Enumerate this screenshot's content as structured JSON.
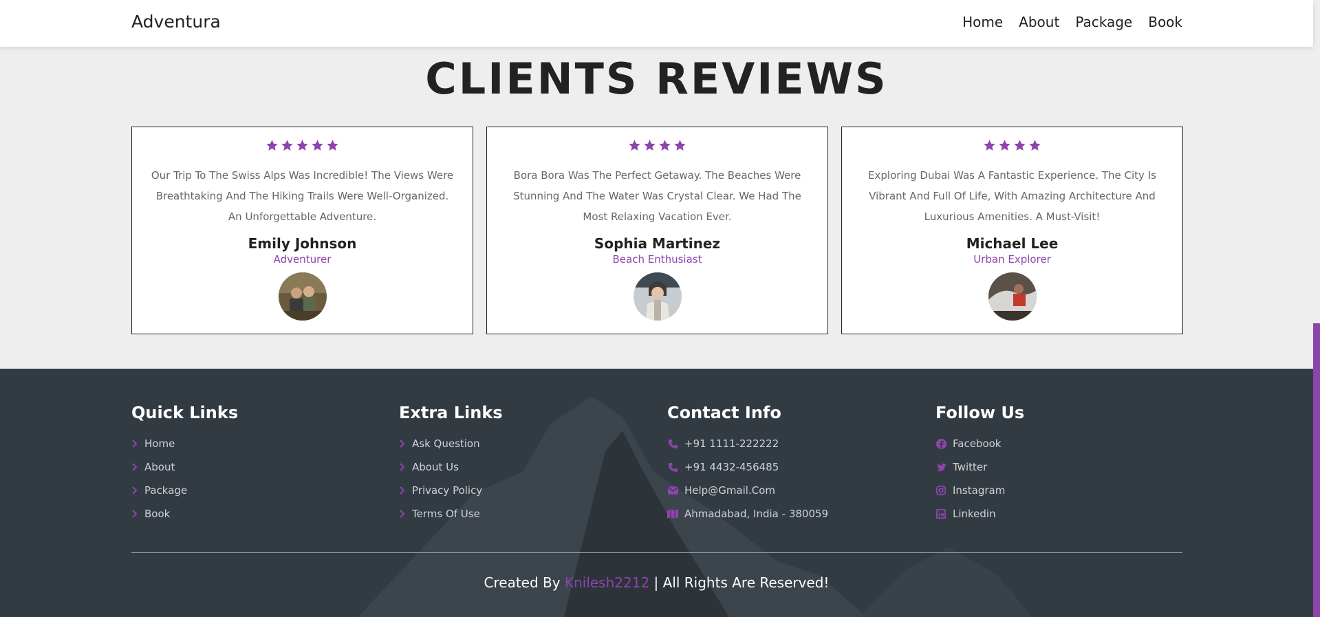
{
  "header": {
    "logo": "Adventura",
    "nav": [
      "Home",
      "About",
      "Package",
      "Book"
    ]
  },
  "reviews": {
    "title": "CLIENTS REVIEWS",
    "cards": [
      {
        "stars": 5,
        "text": "Our Trip To The Swiss Alps Was Incredible! The Views Were Breathtaking And The Hiking Trails Were Well-Organized. An Unforgettable Adventure.",
        "name": "Emily Johnson",
        "role": "Adventurer"
      },
      {
        "stars": 4,
        "text": "Bora Bora Was The Perfect Getaway. The Beaches Were Stunning And The Water Was Crystal Clear. We Had The Most Relaxing Vacation Ever.",
        "name": "Sophia Martinez",
        "role": "Beach Enthusiast"
      },
      {
        "stars": 4,
        "text": "Exploring Dubai Was A Fantastic Experience. The City Is Vibrant And Full Of Life, With Amazing Architecture And Luxurious Amenities. A Must-Visit!",
        "name": "Michael Lee",
        "role": "Urban Explorer"
      }
    ]
  },
  "footer": {
    "quick_links": {
      "title": "Quick Links",
      "items": [
        "Home",
        "About",
        "Package",
        "Book"
      ]
    },
    "extra_links": {
      "title": "Extra Links",
      "items": [
        "Ask Question",
        "About Us",
        "Privacy Policy",
        "Terms Of Use"
      ]
    },
    "contact_info": {
      "title": "Contact Info",
      "items": [
        {
          "icon": "phone-icon",
          "text": "+91 1111-222222"
        },
        {
          "icon": "phone-icon",
          "text": "+91 4432-456485"
        },
        {
          "icon": "envelope-icon",
          "text": "Help@Gmail.Com"
        },
        {
          "icon": "map-icon",
          "text": "Ahmadabad, India - 380059"
        }
      ]
    },
    "follow_us": {
      "title": "Follow Us",
      "items": [
        {
          "icon": "facebook-icon",
          "text": "Facebook"
        },
        {
          "icon": "twitter-icon",
          "text": "Twitter"
        },
        {
          "icon": "instagram-icon",
          "text": "Instagram"
        },
        {
          "icon": "linkedin-icon",
          "text": "Linkedin"
        }
      ]
    },
    "credit": {
      "prefix": "Created By",
      "author": "Knilesh2212",
      "suffix": "| All Rights Are Reserved!"
    }
  },
  "colors": {
    "accent": "#8e44ad",
    "text_dark": "#222222",
    "footer_bg": "#333b42",
    "page_bg": "#eeeeee"
  }
}
